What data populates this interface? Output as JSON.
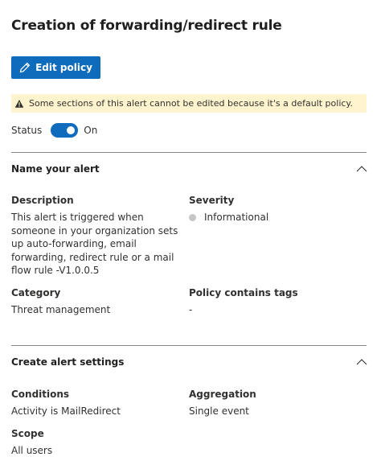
{
  "page": {
    "title": "Creation of forwarding/redirect rule"
  },
  "toolbar": {
    "edit_label": "Edit policy"
  },
  "warning": {
    "text": "Some sections of this alert cannot be edited because it's a default policy."
  },
  "status": {
    "label": "Status",
    "toggle_state": "On",
    "enabled": true
  },
  "section_name": {
    "title": "Name your alert",
    "description_label": "Description",
    "description_lines": [
      "This alert is triggered when",
      "someone in your organization sets",
      "up auto-forwarding, email",
      "forwarding, redirect rule or a mail",
      "flow rule -V1.0.0.5"
    ],
    "severity_label": "Severity",
    "severity_value": "Informational",
    "category_label": "Category",
    "category_value": "Threat management",
    "tags_label": "Policy contains tags",
    "tags_value": "-"
  },
  "section_settings": {
    "title": "Create alert settings",
    "conditions_label": "Conditions",
    "conditions_value": "Activity is MailRedirect",
    "aggregation_label": "Aggregation",
    "aggregation_value": "Single event",
    "scope_label": "Scope",
    "scope_value": "All users"
  },
  "colors": {
    "accent": "#0f6cbd",
    "warning_bg": "#fff4ce",
    "severity_dot": "#c8c6c4"
  },
  "icons": {
    "edit": "pencil-icon",
    "warning": "warning-icon",
    "collapse": "chevron-up-icon"
  }
}
